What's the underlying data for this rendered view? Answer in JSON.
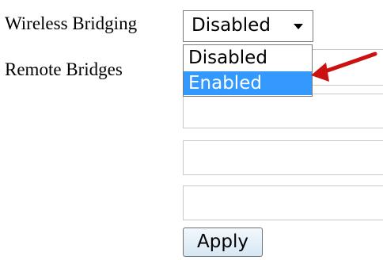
{
  "form": {
    "wireless_bridging_label": "Wireless Bridging",
    "remote_bridges_label": "Remote Bridges",
    "select_value": "Disabled",
    "options": [
      {
        "label": "Disabled",
        "highlighted": false
      },
      {
        "label": "Enabled",
        "highlighted": true
      }
    ],
    "remote_bridge_values": [
      "",
      "",
      "",
      ""
    ],
    "apply_label": "Apply"
  },
  "colors": {
    "highlight": "#3399ff",
    "annotation_arrow": "#cc1111"
  },
  "icons": {
    "dropdown": "chevron-down-icon",
    "annotation": "arrow-annotation-icon"
  }
}
